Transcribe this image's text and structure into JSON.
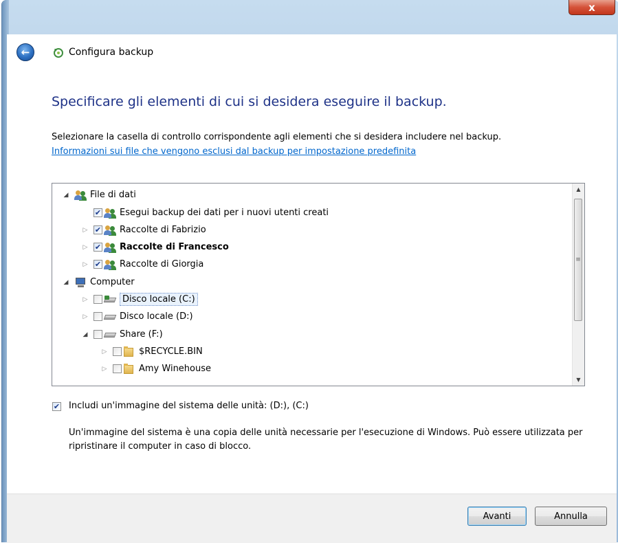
{
  "window": {
    "title": "Configura backup",
    "close_glyph": "x"
  },
  "nav": {
    "back_glyph": "←"
  },
  "page": {
    "heading": "Specificare gli elementi di cui si desidera eseguire il backup.",
    "instruction": "Selezionare la casella di controllo corrispondente agli elementi che si desidera includere nel backup.",
    "info_link": "Informazioni sui file che vengono esclusi dal backup per impostazione predefinita"
  },
  "tree": {
    "items": [
      {
        "label": "File di dati",
        "expander": "◢",
        "checked": null,
        "icon": "users-icon"
      },
      {
        "label": "Esegui backup dei dati per i nuovi utenti creati",
        "expander": "",
        "checked": true,
        "icon": "users-icon"
      },
      {
        "label": "Raccolte di Fabrizio",
        "expander": "▷",
        "checked": true,
        "icon": "users-icon"
      },
      {
        "label": "Raccolte di Francesco",
        "expander": "▷",
        "checked": true,
        "icon": "users-icon",
        "bold": true
      },
      {
        "label": "Raccolte di Giorgia",
        "expander": "▷",
        "checked": true,
        "icon": "users-icon"
      },
      {
        "label": "Computer",
        "expander": "◢",
        "checked": null,
        "icon": "computer-icon"
      },
      {
        "label": "Disco locale (C:)",
        "expander": "▷",
        "checked": false,
        "icon": "system-drive-icon",
        "selected": true
      },
      {
        "label": "Disco locale (D:)",
        "expander": "▷",
        "checked": false,
        "icon": "drive-icon"
      },
      {
        "label": "Share (F:)",
        "expander": "◢",
        "checked": false,
        "icon": "drive-icon"
      },
      {
        "label": "$RECYCLE.BIN",
        "expander": "▷",
        "checked": false,
        "icon": "folder-icon"
      },
      {
        "label": "Amy Winehouse",
        "expander": "▷",
        "checked": false,
        "icon": "folder-icon"
      }
    ],
    "scroll_up_glyph": "▲",
    "scroll_down_glyph": "▼",
    "thumb_grip": "≡"
  },
  "system_image": {
    "checked": true,
    "label": "Includi un'immagine del sistema delle unità: (D:), (C:)",
    "description": "Un'immagine del sistema è una copia delle unità necessarie per l'esecuzione di Windows. Può essere utilizzata per ripristinare il computer in caso di blocco."
  },
  "buttons": {
    "next": "Avanti",
    "cancel": "Annulla"
  },
  "check_glyph": "✔"
}
